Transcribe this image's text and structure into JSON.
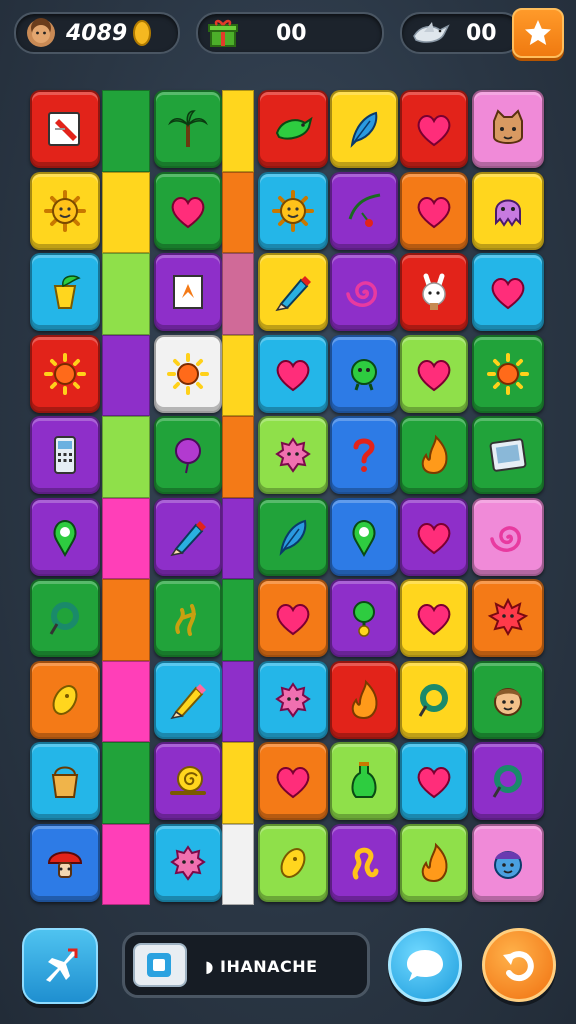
{
  "hud": {
    "coins_value": "4089",
    "gifts_value": "00",
    "birds_value": "00"
  },
  "bottom_bar": {
    "name_label": "◗ IHANACHE"
  },
  "colors": {
    "red": "#e2231a",
    "green": "#21a33a",
    "lime": "#8fe04a",
    "yellow": "#ffd61e",
    "orange": "#f47a17",
    "cyan": "#24b6e8",
    "purple": "#8e2fc9",
    "pink": "#f08ad8",
    "magenta": "#ff3fb8",
    "blue": "#2d7be6",
    "white": "#f2f2f2",
    "rose": "#d06a98"
  },
  "board": {
    "rows": [
      [
        "red:document-icon",
        "green:blank",
        "green:palm-tree-icon",
        "yellow:blank",
        "red:bird-icon",
        "yellow:feather-icon",
        "red:heart-icon",
        "pink:cat-face-icon"
      ],
      [
        "yellow:sun-face-icon",
        "yellow:blank",
        "green:heart-icon",
        "orange:blank",
        "cyan:sun-face-icon",
        "purple:cherry-branch-icon",
        "orange:heart-icon",
        "yellow:octopus-icon"
      ],
      [
        "cyan:leaf-cup-icon",
        "lime:blank",
        "purple:paper-icon",
        "rose:blank",
        "yellow:crayon-icon",
        "purple:spiral-icon",
        "red:bunny-icon",
        "cyan:heart-icon"
      ],
      [
        "red:sun-icon",
        "purple:blank",
        "white:sun-icon",
        "yellow:blank",
        "cyan:heart-icon",
        "blue:blob-creature-icon",
        "lime:heart-icon",
        "green:sun-icon"
      ],
      [
        "purple:phone-icon",
        "lime:blank",
        "green:balloon-icon",
        "orange:blank",
        "lime:puffball-icon",
        "blue:question-icon",
        "green:flame-icon",
        "green:tablet-icon"
      ],
      [
        "purple:pin-icon",
        "magenta:blank",
        "purple:crayon-icon",
        "purple:blank",
        "green:feather-icon",
        "blue:pin-icon",
        "purple:heart-icon",
        "pink:spiral-icon"
      ],
      [
        "green:ring-icon",
        "orange:blank",
        "green:vine-icon",
        "green:blank",
        "orange:heart-icon",
        "purple:sprout-icon",
        "yellow:heart-icon",
        "orange:flower-face-icon"
      ],
      [
        "orange:seed-icon",
        "magenta:blank",
        "cyan:pencil-icon",
        "purple:blank",
        "cyan:puffball-icon",
        "red:flame-icon",
        "yellow:ring-icon",
        "green:kid-face-icon"
      ],
      [
        "cyan:bucket-icon",
        "green:blank",
        "purple:snail-icon",
        "yellow:blank",
        "orange:heart-icon",
        "lime:potion-icon",
        "cyan:heart-icon",
        "purple:ring-icon"
      ],
      [
        "blue:mushroom-icon",
        "magenta:blank",
        "cyan:puffball-icon",
        "white:blank",
        "lime:seed-icon",
        "purple:squiggle-icon",
        "lime:flame-icon",
        "pink:blue-face-icon"
      ]
    ]
  }
}
